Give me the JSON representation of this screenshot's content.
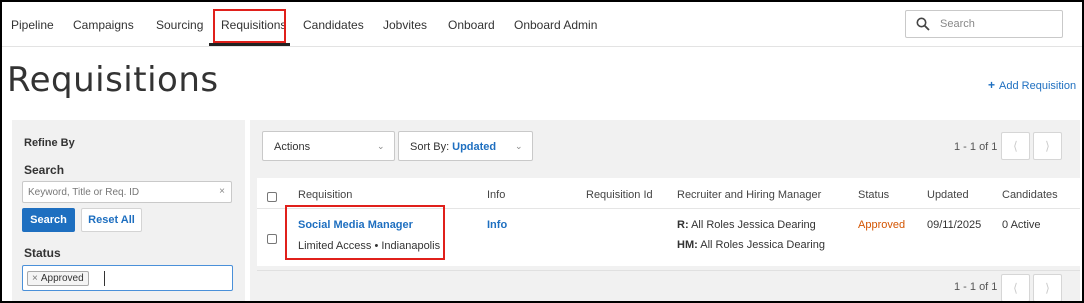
{
  "nav": {
    "items": [
      "Pipeline",
      "Campaigns",
      "Sourcing",
      "Requisitions",
      "Candidates",
      "Jobvites",
      "Onboard",
      "Onboard Admin"
    ],
    "search_placeholder": "Search",
    "search_icon": "search-icon"
  },
  "header": {
    "title": "Requisitions",
    "add_label": "Add Requisition",
    "add_icon": "plus-icon"
  },
  "sidebar": {
    "refine_by": "Refine By",
    "search_label": "Search",
    "keyword_placeholder": "Keyword, Title or Req. ID",
    "clear_glyph": "×",
    "search_button": "Search",
    "reset_button": "Reset All",
    "status_label": "Status",
    "status_chip": "Approved",
    "chip_remove": "×"
  },
  "toolbar": {
    "actions_label": "Actions",
    "sort_label": "Sort By:",
    "sort_value": "Updated",
    "pager_text": "1 - 1 of 1"
  },
  "table": {
    "headers": [
      "Requisition",
      "Info",
      "Requisition Id",
      "Recruiter and Hiring Manager",
      "Status",
      "Updated",
      "Candidates"
    ],
    "rows": [
      {
        "title": "Social Media Manager",
        "access": "Limited Access",
        "separator": "•",
        "location": "Indianapolis",
        "info": "Info",
        "requisition_id": "",
        "recruiter_prefix": "R:",
        "recruiter": "All Roles Jessica Dearing",
        "hm_prefix": "HM:",
        "hiring_manager": "All Roles Jessica Dearing",
        "status": "Approved",
        "updated": "09/11/2025",
        "candidates": "0 Active"
      }
    ]
  },
  "footer": {
    "pager_text": "1 - 1 of 1"
  },
  "colors": {
    "accent": "#1e6fc0",
    "highlight": "#e0201b",
    "status_approved": "#d35400"
  }
}
